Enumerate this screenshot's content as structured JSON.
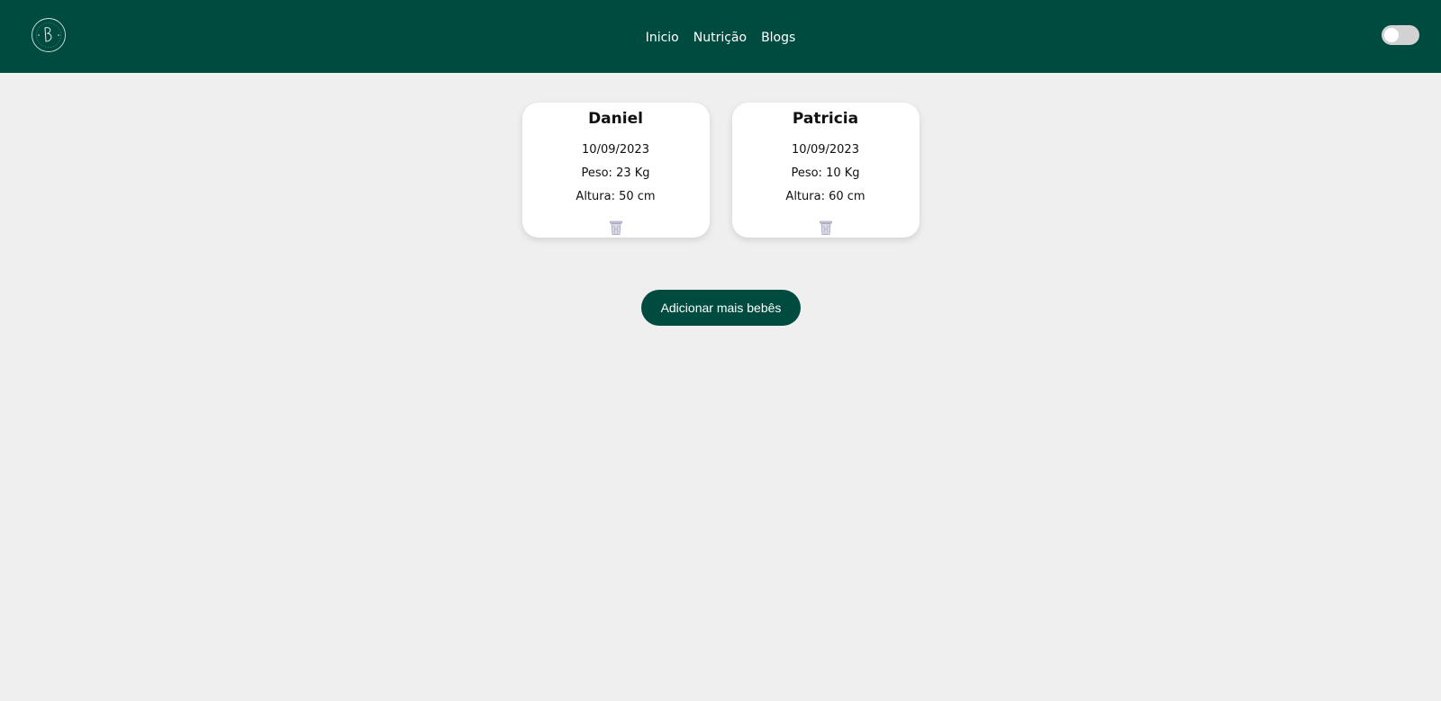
{
  "nav": {
    "links": [
      {
        "label": "Inicio"
      },
      {
        "label": "Nutrição"
      },
      {
        "label": "Blogs"
      }
    ],
    "logo_icon": "baby-logo-icon",
    "theme_toggle_state": "off"
  },
  "babies": [
    {
      "name": "Daniel",
      "date": "10/09/2023",
      "weight": "Peso: 23 Kg",
      "height": "Altura: 50 cm",
      "delete_icon": "trash-icon"
    },
    {
      "name": "Patricia",
      "date": "10/09/2023",
      "weight": "Peso: 10 Kg",
      "height": "Altura: 60 cm",
      "delete_icon": "trash-icon"
    }
  ],
  "add_button_label": "Adicionar mais bebês",
  "colors": {
    "brand": "#004b40",
    "background": "#f0efef",
    "card": "#ffffff"
  }
}
